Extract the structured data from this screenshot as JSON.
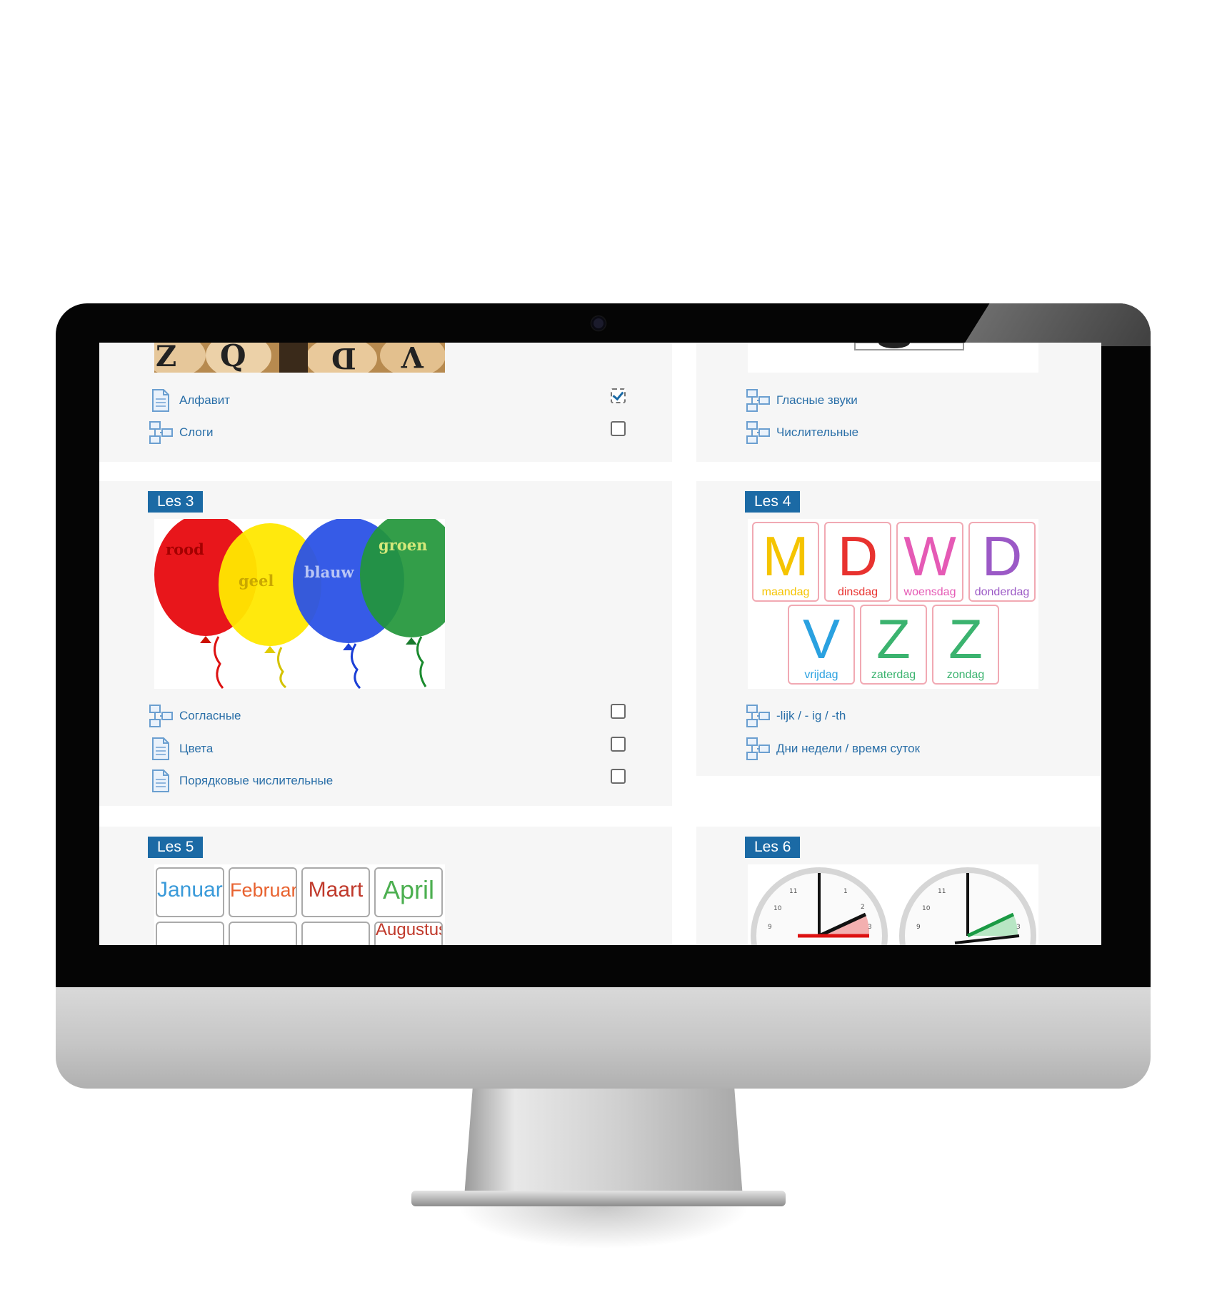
{
  "lessons": {
    "top_left": {
      "items": [
        {
          "label": "Алфавит",
          "type": "page",
          "completed": true
        },
        {
          "label": "Слоги",
          "type": "glossary",
          "completed": false
        }
      ],
      "image_letters": [
        "Z",
        "Q",
        "D",
        "V"
      ]
    },
    "top_right": {
      "items": [
        {
          "label": "Гласные звуки",
          "type": "glossary"
        },
        {
          "label": "Числительные",
          "type": "glossary"
        }
      ]
    },
    "les3": {
      "badge": "Les 3",
      "balloon_words": [
        "rood",
        "geel",
        "blauw",
        "groen"
      ],
      "items": [
        {
          "label": "Согласные",
          "type": "glossary",
          "completed": false
        },
        {
          "label": "Цвета",
          "type": "page",
          "completed": false
        },
        {
          "label": "Порядковые числительные",
          "type": "page",
          "completed": false
        }
      ]
    },
    "les4": {
      "badge": "Les 4",
      "days": [
        {
          "letter": "M",
          "word": "maandag",
          "color": "#f5c400"
        },
        {
          "letter": "D",
          "word": "dinsdag",
          "color": "#e8322f"
        },
        {
          "letter": "W",
          "word": "woensdag",
          "color": "#e55ab5"
        },
        {
          "letter": "D",
          "word": "donderdag",
          "color": "#9b59c6"
        },
        {
          "letter": "V",
          "word": "vrijdag",
          "color": "#2aa1e0"
        },
        {
          "letter": "Z",
          "word": "zaterdag",
          "color": "#3bb36f"
        },
        {
          "letter": "Z",
          "word": "zondag",
          "color": "#3bb36f"
        }
      ],
      "items": [
        {
          "label": "-lijk / - ig / -th",
          "type": "glossary"
        },
        {
          "label": "Дни недели / время суток",
          "type": "glossary"
        }
      ]
    },
    "les5": {
      "badge": "Les 5",
      "months": [
        {
          "name": "Januari",
          "color": "#3a9ad9"
        },
        {
          "name": "Februari",
          "color": "#e8622f"
        },
        {
          "name": "Maart",
          "color": "#c0392b"
        },
        {
          "name": "April",
          "color": "#4caf50"
        },
        {
          "name": "Augustus",
          "color": "#c0392b"
        }
      ]
    },
    "les6": {
      "badge": "Les 6",
      "clock_numbers": [
        "11",
        "12",
        "1",
        "10",
        "2",
        "9",
        "3"
      ]
    }
  },
  "colors": {
    "accent": "#1b6aa5",
    "link": "#2a6fa8",
    "card_bg": "#f6f6f6"
  }
}
